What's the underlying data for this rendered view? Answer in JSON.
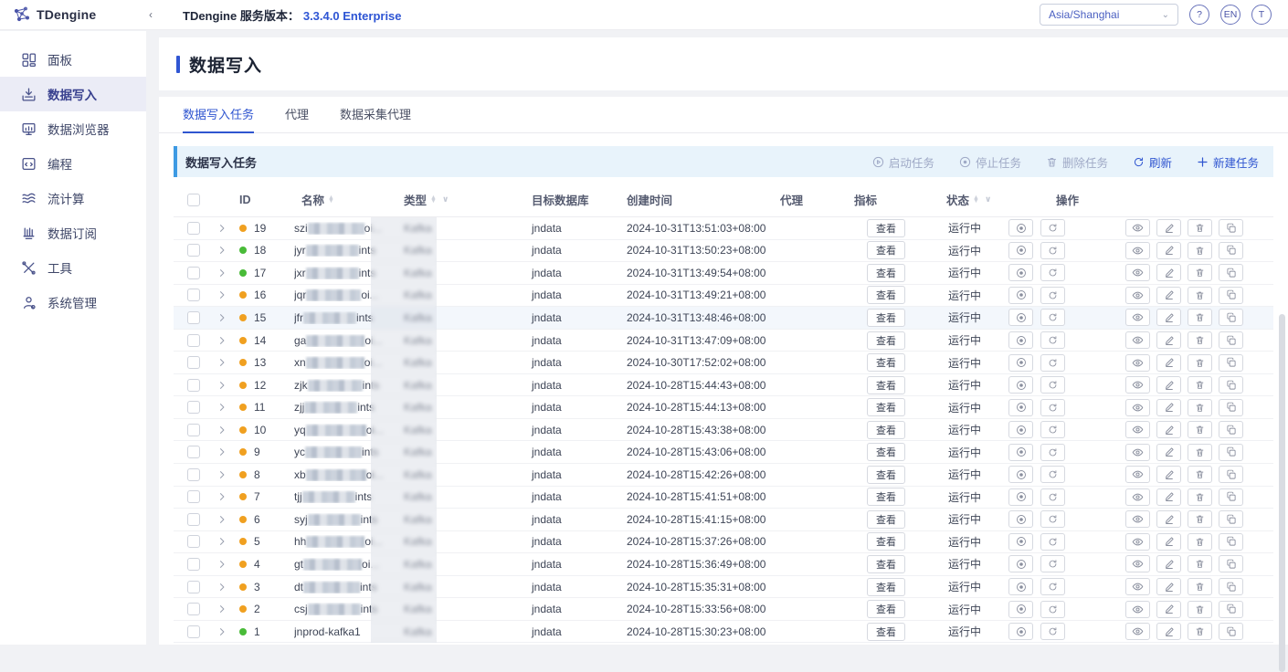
{
  "colors": {
    "accent_blue": "#2f55d0",
    "toolbar_bg": "#e8f3fb",
    "toolbar_accent": "#3d9ae3",
    "dot_orange": "#f0a020",
    "dot_green": "#49bb38",
    "sidebar_active_bg": "#ebecf6"
  },
  "topbar": {
    "logo_text": "TDengine",
    "collapse_icon": "‹",
    "version_label": "TDengine 服务版本：",
    "version_value": "3.3.4.0 Enterprise",
    "timezone_value": "Asia/Shanghai",
    "help_label": "?",
    "lang_label": "EN",
    "avatar_label": "T"
  },
  "sidebar": {
    "items": [
      {
        "label": "面板",
        "icon": "dashboard-icon",
        "active": false
      },
      {
        "label": "数据写入",
        "icon": "data-in-icon",
        "active": true
      },
      {
        "label": "数据浏览器",
        "icon": "explorer-icon",
        "active": false
      },
      {
        "label": "编程",
        "icon": "code-icon",
        "active": false
      },
      {
        "label": "流计算",
        "icon": "stream-icon",
        "active": false
      },
      {
        "label": "数据订阅",
        "icon": "subscribe-icon",
        "active": false
      },
      {
        "label": "工具",
        "icon": "tools-icon",
        "active": false
      },
      {
        "label": "系统管理",
        "icon": "system-icon",
        "active": false
      }
    ]
  },
  "page": {
    "title": "数据写入"
  },
  "tabs": [
    {
      "label": "数据写入任务",
      "active": true
    },
    {
      "label": "代理",
      "active": false
    },
    {
      "label": "数据采集代理",
      "active": false
    }
  ],
  "toolbar": {
    "title": "数据写入任务",
    "actions": [
      {
        "label": "启动任务",
        "icon": "play-circle-icon",
        "enabled": false
      },
      {
        "label": "停止任务",
        "icon": "stop-circle-icon",
        "enabled": false
      },
      {
        "label": "删除任务",
        "icon": "trash-icon",
        "enabled": false
      },
      {
        "label": "刷新",
        "icon": "refresh-icon",
        "enabled": true
      },
      {
        "label": "新建任务",
        "icon": "plus-icon",
        "enabled": true
      }
    ]
  },
  "table": {
    "columns": {
      "id": "ID",
      "name": "名称",
      "type": "类型",
      "db": "目标数据库",
      "created": "创建时间",
      "agent": "代理",
      "metrics": "指标",
      "status": "状态",
      "ops": "操作"
    },
    "metrics_button_label": "查看",
    "rows": [
      {
        "id": "19",
        "dot": "orange",
        "name_prefix": "szi",
        "redacted": true,
        "redact_w": 62,
        "name_suffix": "oi...",
        "type": "Kafka",
        "db": "jndata",
        "created": "2024-10-31T13:51:03+08:00",
        "status": "运行中",
        "hovered": false
      },
      {
        "id": "18",
        "dot": "green",
        "name_prefix": "jyr",
        "redacted": true,
        "redact_w": 58,
        "name_suffix": "ints",
        "type": "Kafka",
        "db": "jndata",
        "created": "2024-10-31T13:50:23+08:00",
        "status": "运行中",
        "hovered": false
      },
      {
        "id": "17",
        "dot": "green",
        "name_prefix": "jxr",
        "redacted": true,
        "redact_w": 58,
        "name_suffix": "ints",
        "type": "Kafka",
        "db": "jndata",
        "created": "2024-10-31T13:49:54+08:00",
        "status": "运行中",
        "hovered": false
      },
      {
        "id": "16",
        "dot": "orange",
        "name_prefix": "jqr",
        "redacted": true,
        "redact_w": 60,
        "name_suffix": "oi...",
        "type": "Kafka",
        "db": "jndata",
        "created": "2024-10-31T13:49:21+08:00",
        "status": "运行中",
        "hovered": false
      },
      {
        "id": "15",
        "dot": "orange",
        "name_prefix": "jfr",
        "redacted": true,
        "redact_w": 58,
        "name_suffix": "ints",
        "type": "Kafka",
        "db": "jndata",
        "created": "2024-10-31T13:48:46+08:00",
        "status": "运行中",
        "hovered": true
      },
      {
        "id": "14",
        "dot": "orange",
        "name_prefix": "ga",
        "redacted": true,
        "redact_w": 64,
        "name_suffix": "oi...",
        "type": "Kafka",
        "db": "jndata",
        "created": "2024-10-31T13:47:09+08:00",
        "status": "运行中",
        "hovered": false
      },
      {
        "id": "13",
        "dot": "orange",
        "name_prefix": "xn",
        "redacted": true,
        "redact_w": 64,
        "name_suffix": "oi...",
        "type": "Kafka",
        "db": "jndata",
        "created": "2024-10-30T17:52:02+08:00",
        "status": "运行中",
        "hovered": false
      },
      {
        "id": "12",
        "dot": "orange",
        "name_prefix": "zjk",
        "redacted": true,
        "redact_w": 60,
        "name_suffix": "ints",
        "type": "Kafka",
        "db": "jndata",
        "created": "2024-10-28T15:44:43+08:00",
        "status": "运行中",
        "hovered": false
      },
      {
        "id": "11",
        "dot": "orange",
        "name_prefix": "zjj",
        "redacted": true,
        "redact_w": 58,
        "name_suffix": "ints",
        "type": "Kafka",
        "db": "jndata",
        "created": "2024-10-28T15:44:13+08:00",
        "status": "运行中",
        "hovered": false
      },
      {
        "id": "10",
        "dot": "orange",
        "name_prefix": "yq",
        "redacted": true,
        "redact_w": 66,
        "name_suffix": "oi...",
        "type": "Kafka",
        "db": "jndata",
        "created": "2024-10-28T15:43:38+08:00",
        "status": "运行中",
        "hovered": false
      },
      {
        "id": "9",
        "dot": "orange",
        "name_prefix": "yc",
        "redacted": true,
        "redact_w": 62,
        "name_suffix": "ints",
        "type": "Kafka",
        "db": "jndata",
        "created": "2024-10-28T15:43:06+08:00",
        "status": "运行中",
        "hovered": false
      },
      {
        "id": "8",
        "dot": "orange",
        "name_prefix": "xb",
        "redacted": true,
        "redact_w": 66,
        "name_suffix": "oi...",
        "type": "Kafka",
        "db": "jndata",
        "created": "2024-10-28T15:42:26+08:00",
        "status": "运行中",
        "hovered": false
      },
      {
        "id": "7",
        "dot": "orange",
        "name_prefix": "tjj",
        "redacted": true,
        "redact_w": 58,
        "name_suffix": "ints",
        "type": "Kafka",
        "db": "jndata",
        "created": "2024-10-28T15:41:51+08:00",
        "status": "运行中",
        "hovered": false
      },
      {
        "id": "6",
        "dot": "orange",
        "name_prefix": "syj",
        "redacted": true,
        "redact_w": 58,
        "name_suffix": "ints",
        "type": "Kafka",
        "db": "jndata",
        "created": "2024-10-28T15:41:15+08:00",
        "status": "运行中",
        "hovered": false
      },
      {
        "id": "5",
        "dot": "orange",
        "name_prefix": "hh",
        "redacted": true,
        "redact_w": 64,
        "name_suffix": "oi...",
        "type": "Kafka",
        "db": "jndata",
        "created": "2024-10-28T15:37:26+08:00",
        "status": "运行中",
        "hovered": false
      },
      {
        "id": "4",
        "dot": "orange",
        "name_prefix": "gt",
        "redacted": true,
        "redact_w": 64,
        "name_suffix": "oi...",
        "type": "Kafka",
        "db": "jndata",
        "created": "2024-10-28T15:36:49+08:00",
        "status": "运行中",
        "hovered": false
      },
      {
        "id": "3",
        "dot": "orange",
        "name_prefix": "dt",
        "redacted": true,
        "redact_w": 62,
        "name_suffix": "ints",
        "type": "Kafka",
        "db": "jndata",
        "created": "2024-10-28T15:35:31+08:00",
        "status": "运行中",
        "hovered": false
      },
      {
        "id": "2",
        "dot": "orange",
        "name_prefix": "csj",
        "redacted": true,
        "redact_w": 58,
        "name_suffix": "ints",
        "type": "Kafka",
        "db": "jndata",
        "created": "2024-10-28T15:33:56+08:00",
        "status": "运行中",
        "hovered": false
      },
      {
        "id": "1",
        "dot": "green",
        "name_prefix": "jnprod-kafka1",
        "redacted": false,
        "redact_w": 0,
        "name_suffix": "",
        "type": "Kafka",
        "db": "jndata",
        "created": "2024-10-28T15:30:23+08:00",
        "status": "运行中",
        "hovered": false
      }
    ]
  }
}
